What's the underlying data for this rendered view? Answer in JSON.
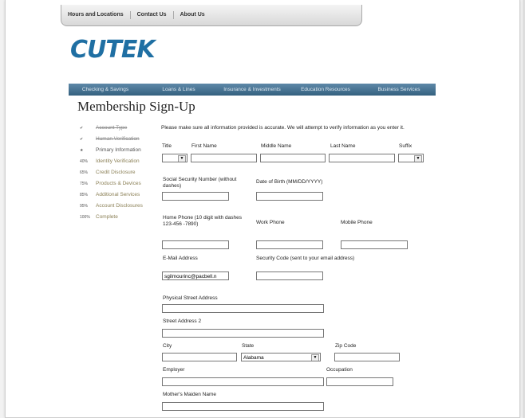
{
  "top_nav": [
    "Hours and Locations",
    "Contact Us",
    "About Us"
  ],
  "logo": {
    "text": "CUTEK"
  },
  "main_nav": [
    "Checking & Savings",
    "Loans & Lines",
    "Insurance & Investments",
    "Education Resources",
    "Business Services"
  ],
  "page_title": "Membership Sign-Up",
  "steps": [
    {
      "label": "Account Type",
      "marker": "check",
      "state": "done"
    },
    {
      "label": "Human Verification",
      "marker": "check",
      "state": "done"
    },
    {
      "label": "Primary Information",
      "marker": "star",
      "state": "current"
    },
    {
      "label": "Identity Verification",
      "marker": "40%",
      "state": "future"
    },
    {
      "label": "Credit Disclosure",
      "marker": "65%",
      "state": "future"
    },
    {
      "label": "Products & Devices",
      "marker": "75%",
      "state": "future"
    },
    {
      "label": "Additional Services",
      "marker": "85%",
      "state": "future"
    },
    {
      "label": "Account Disclosures",
      "marker": "95%",
      "state": "future"
    },
    {
      "label": "Complete",
      "marker": "100%",
      "state": "future"
    }
  ],
  "intro": "Please make sure all information provided is accurate. We will attempt to verify information as you enter it.",
  "labels": {
    "title": "Title",
    "first_name": "First Name",
    "middle_name": "Middle Name",
    "last_name": "Last Name",
    "suffix": "Suffix",
    "ssn": "Social Security Number (without dashes)",
    "dob": "Date of Birth (MM/DD/YYYY)",
    "home_phone": "Home Phone (10 digit with dashes 123-456 -7890)",
    "work_phone": "Work Phone",
    "mobile_phone": "Mobile Phone",
    "email": "E-Mail Address",
    "security_code": "Security Code (sent to your email address)",
    "street1": "Physical Street Address",
    "street2": "Street Address 2",
    "city": "City",
    "state": "State",
    "zip": "Zip Code",
    "employer": "Employer",
    "occupation": "Occupation",
    "maiden": "Mother's Maiden Name"
  },
  "values": {
    "email": "sgilmourinc@pacbell.n",
    "state": "Alabama"
  }
}
